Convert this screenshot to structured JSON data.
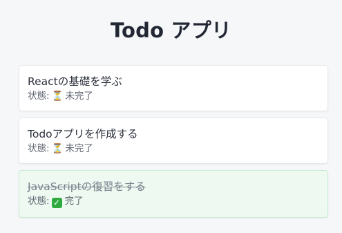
{
  "app": {
    "title": "Todo アプリ"
  },
  "todos": [
    {
      "text": "Reactの基礎を学ぶ",
      "status_label": "状態:",
      "status_icon": "hourglass-icon",
      "status_glyph": "⏳",
      "status_text": "未完了",
      "completed": false
    },
    {
      "text": "Todoアプリを作成する",
      "status_label": "状態:",
      "status_icon": "hourglass-icon",
      "status_glyph": "⏳",
      "status_text": "未完了",
      "completed": false
    },
    {
      "text": "JavaScriptの復習をする",
      "status_label": "状態:",
      "status_icon": "check-mark-icon",
      "status_glyph": "✓",
      "status_text": "完了",
      "completed": true
    }
  ],
  "colors": {
    "completed_background": "#eefaf1",
    "check_green": "#2eaa3f"
  }
}
